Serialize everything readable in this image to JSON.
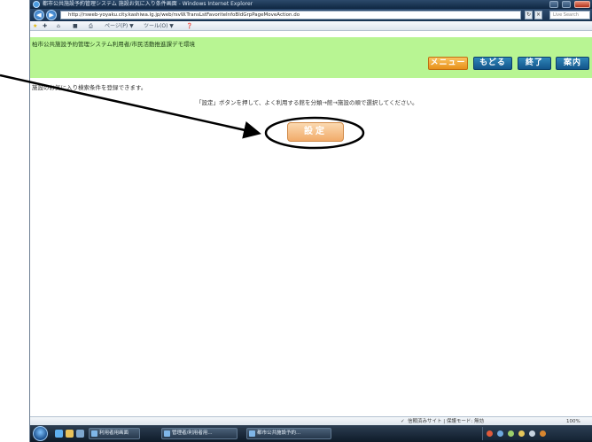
{
  "window": {
    "title": "都市公共施設予約管理システム 施設お気に入り条件画面 - Windows Internet Explorer",
    "url": "http://rsweb-yoyaku.city.kashiwa.lg.jp/web/rsvW.TransLstFavoriteInfoBldGrpPageMoveAction.do",
    "search_placeholder": "Live Search"
  },
  "command_bar": {
    "page_label": "ページ(P) ▼",
    "tools_label": "ツール(O) ▼"
  },
  "app": {
    "title": "柏市公共施設予約管理システム利用者/市民活動推進課デモ環境",
    "buttons": {
      "menu": "メニュー",
      "back": "もどる",
      "logout": "終了",
      "guide": "案内"
    },
    "info_text": "施設のお気に入り検索条件を登録できます。",
    "instruction_text": "「設定」ボタンを押して、よく利用する館を分類→館→施設の順で選択してください。",
    "setting_button_label": "設定"
  },
  "status_bar": {
    "zone_text": "信頼済みサイト | 保護モード: 無効",
    "zoom_text": "100%"
  },
  "taskbar": {
    "tasks": [
      "利用者用画面",
      "管理者/利用者用...",
      "都市公共施設予約..."
    ]
  },
  "colors": {
    "header_green": "#b8f593",
    "nav_button_blue": "#1f6da3",
    "menu_button_orange": "#f0a23a",
    "setting_button_orange": "#f5bd86"
  }
}
